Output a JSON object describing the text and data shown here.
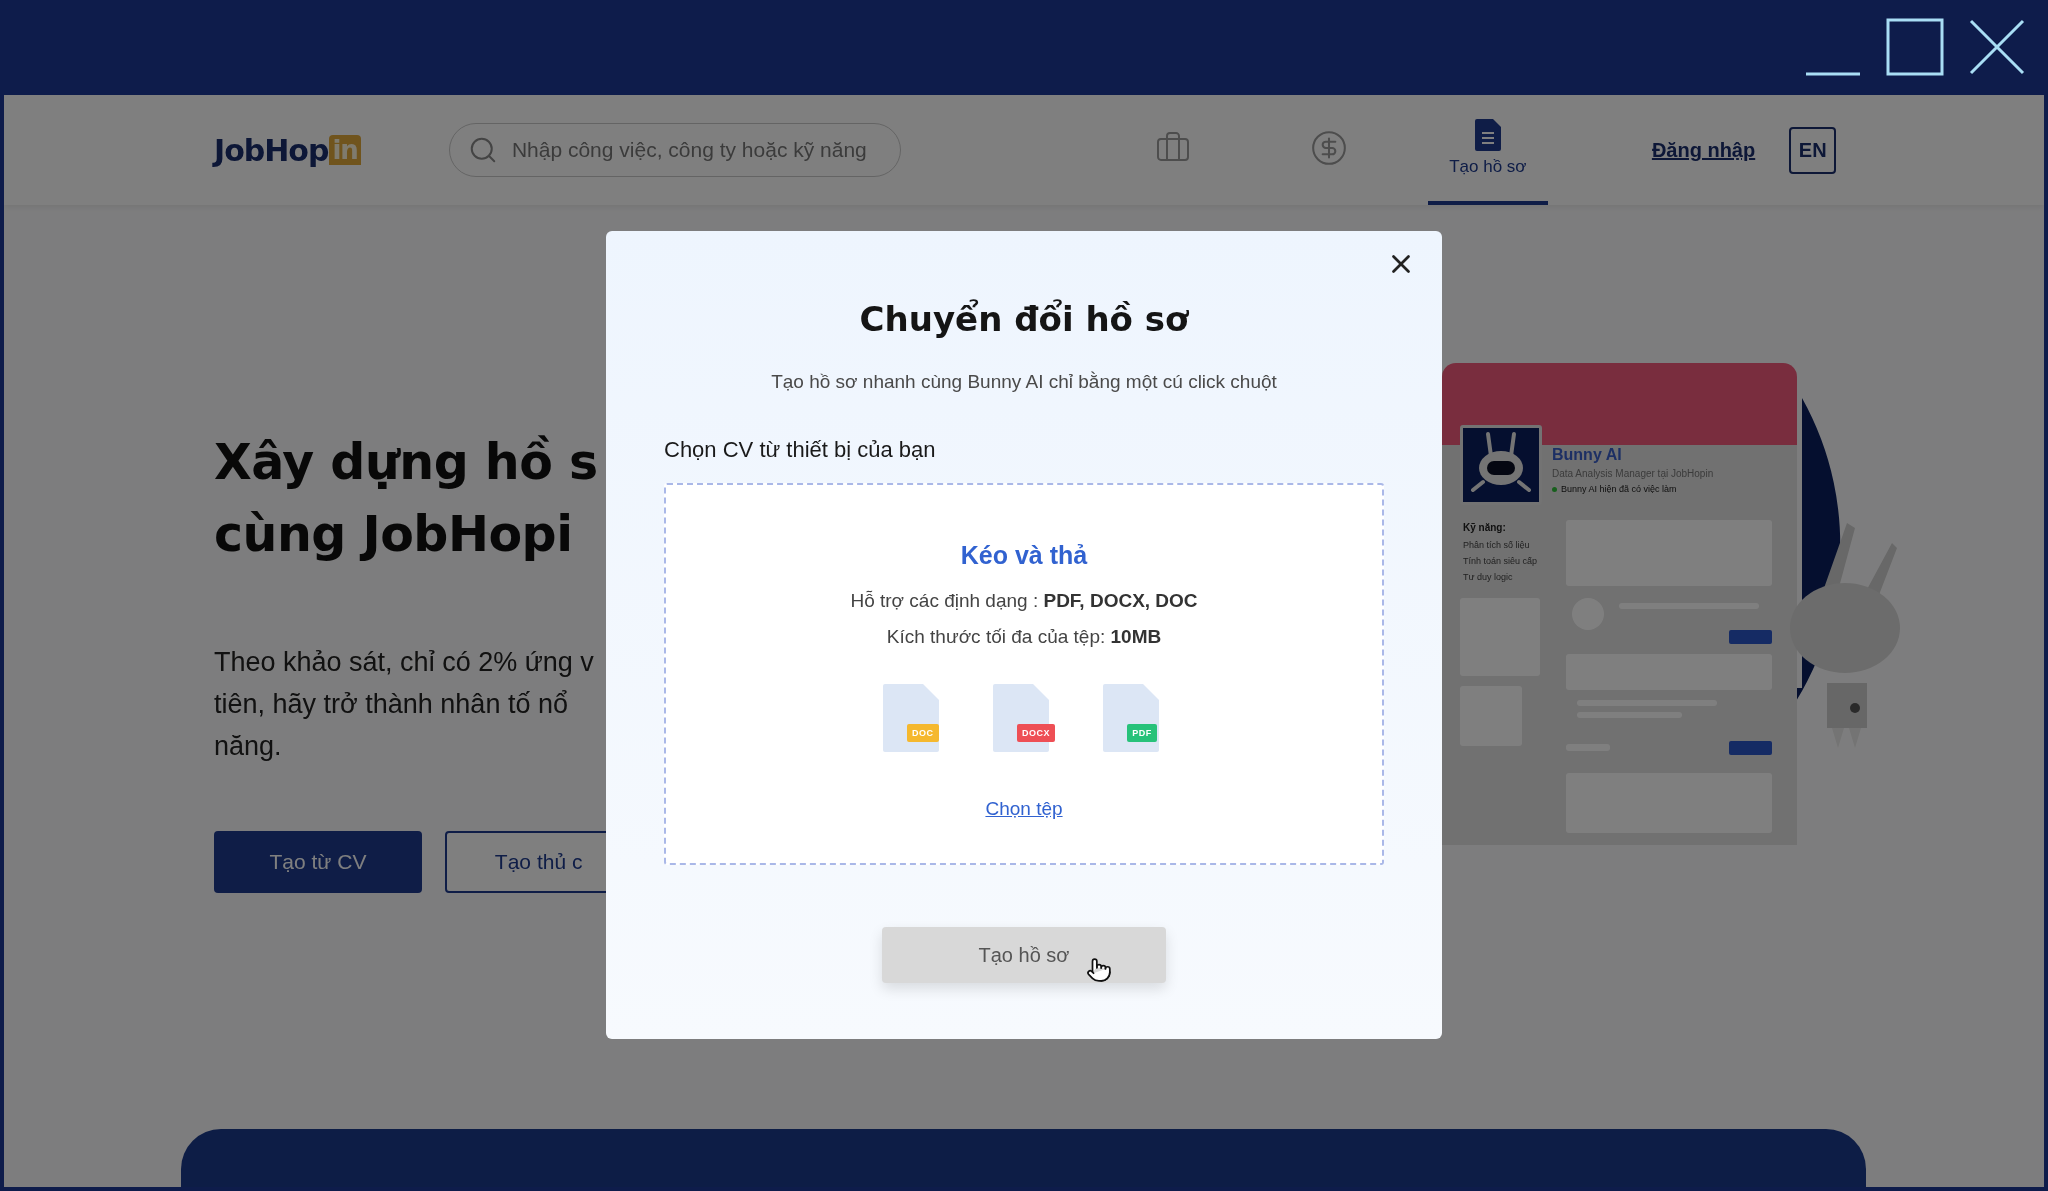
{
  "header": {
    "logo": {
      "main": "JobHop",
      "accent": "in"
    },
    "search": {
      "placeholder": "Nhập công việc, công ty hoặc kỹ năng"
    },
    "nav": [
      {
        "selected": false
      },
      {
        "selected": false
      },
      {
        "label": "Tạo hồ sơ",
        "selected": true
      }
    ],
    "login": "Đăng nhập",
    "language": "EN"
  },
  "hero": {
    "title_lines": [
      "Xây dựng hồ s",
      "cùng JobHopi"
    ],
    "text_lines": [
      "Theo khảo sát, chỉ có 2% ứng v",
      "tiên, hãy trở thành nhân tố nổ",
      "năng."
    ],
    "buttons": [
      {
        "label": "Tạo từ CV",
        "kind": "primary"
      },
      {
        "label": "Tạo thủ c",
        "kind": "outline"
      }
    ]
  },
  "illustration": {
    "name": "Bunny AI",
    "role": "Data Analysis Manager tại JobHopin",
    "status": "Bunny AI hiện đã có việc làm",
    "skills_title": "Kỹ năng:",
    "skills": [
      "Phân tích số liệu",
      "Tính toán siêu cấp",
      "Tư duy logic"
    ]
  },
  "modal": {
    "title": "Chuyển đổi hồ sơ",
    "subtitle": "Tạo hồ sơ nhanh cùng Bunny AI chỉ bằng một cú click chuột",
    "section_label": "Chọn CV từ thiết bị của bạn",
    "dropzone": {
      "heading": "Kéo và thả",
      "formats": "Hỗ trợ các định dạng : **PDF, DOCX, DOC**",
      "size": "Kích thước tối đa của tệp: **10MB**",
      "file_types": [
        {
          "label": "DOC",
          "color": "#f5b82e"
        },
        {
          "label": "DOCX",
          "color": "#ee4f55"
        },
        {
          "label": "PDF",
          "color": "#27c27a"
        }
      ],
      "link": "Chọn tệp"
    },
    "submit": {
      "label": "Tạo hồ sơ",
      "disabled": true
    }
  }
}
